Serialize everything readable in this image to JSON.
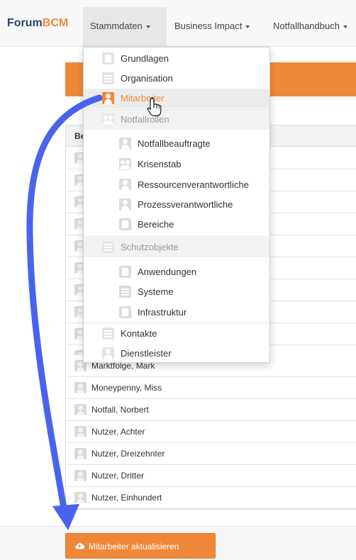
{
  "navbar": {
    "brand_main": "Forum",
    "brand_accent": "BCM",
    "items": [
      {
        "label": "Stammdaten"
      },
      {
        "label": "Business Impact"
      },
      {
        "label": "Notfallhandbuch"
      }
    ]
  },
  "table": {
    "header_label": "Be",
    "rows": [
      {
        "name": "Marktfolge, Mark"
      },
      {
        "name": "Moneypenny, Miss"
      },
      {
        "name": "Notfall, Norbert"
      },
      {
        "name": "Nutzer, Achter"
      },
      {
        "name": "Nutzer, Dreizehnter"
      },
      {
        "name": "Nutzer, Dritter"
      },
      {
        "name": "Nutzer, Einhundert"
      }
    ]
  },
  "dropdown": {
    "items": [
      {
        "label": "Grundlagen",
        "icon": "document-icon"
      },
      {
        "label": "Organisation",
        "icon": "list-icon"
      },
      {
        "label": "Mitarbeiter",
        "icon": "person-icon",
        "active": true
      },
      {
        "label": "Notfallrollen",
        "icon": "group-icon",
        "header": true
      },
      {
        "label": "Notfallbeauftragte",
        "icon": "person-icon"
      },
      {
        "label": "Krisenstab",
        "icon": "group-icon"
      },
      {
        "label": "Ressourcenverantwortliche",
        "icon": "person-icon"
      },
      {
        "label": "Prozessverantwortliche",
        "icon": "person-icon"
      },
      {
        "label": "Bereiche",
        "icon": "building-icon"
      },
      {
        "label": "Schutzobjekte",
        "icon": "list-icon",
        "header": true
      },
      {
        "label": "Anwendungen",
        "icon": "application-icon"
      },
      {
        "label": "Systeme",
        "icon": "server-icon"
      },
      {
        "label": "Infrastruktur",
        "icon": "building-icon"
      },
      {
        "label": "Kontakte",
        "icon": "contact-card-icon"
      },
      {
        "label": "Dienstleister",
        "icon": "provider-icon"
      }
    ]
  },
  "footer": {
    "update_button_label": "Mitarbeiter aktualisieren"
  },
  "colors": {
    "accent": "#f0883a",
    "arrow": "#4a63ee",
    "brand": "#27476b"
  }
}
